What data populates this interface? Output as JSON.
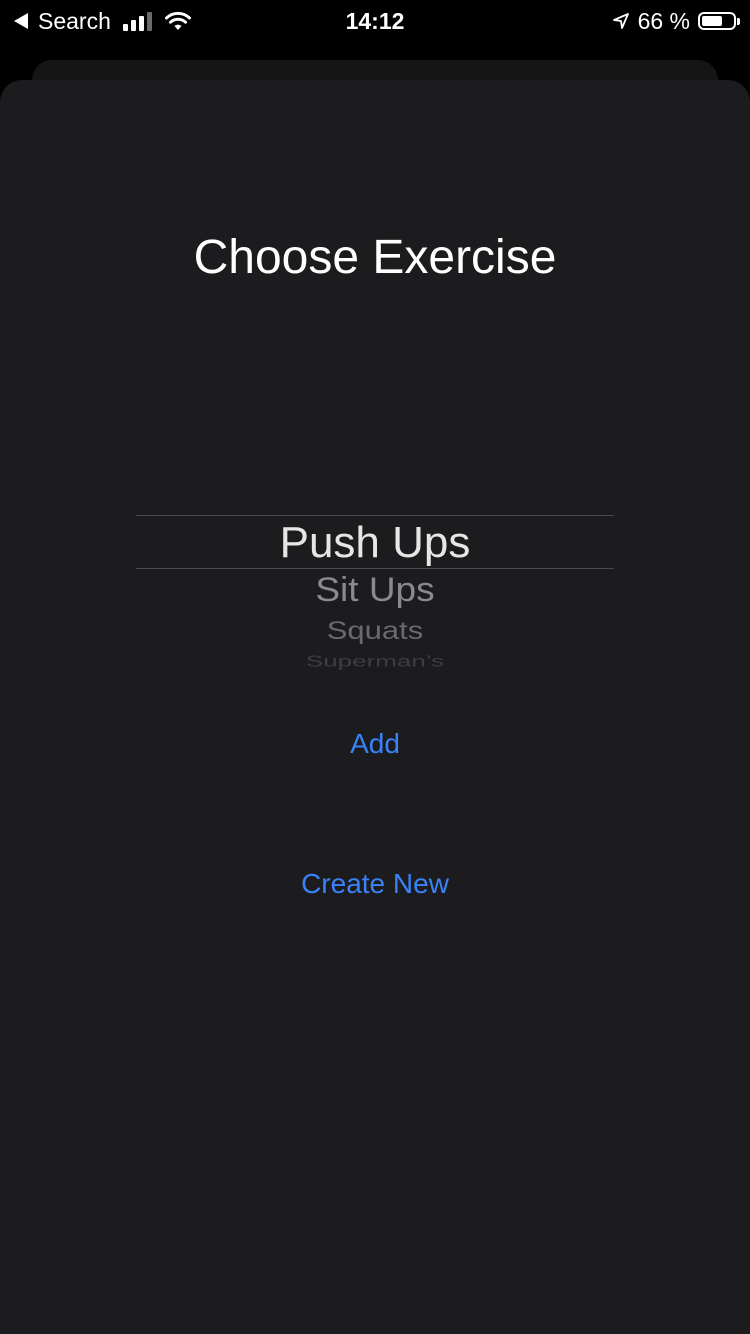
{
  "status_bar": {
    "back_app": "Search",
    "time": "14:12",
    "battery_percent_text": "66 %",
    "battery_level": 0.66,
    "icons": [
      "back-arrow-icon",
      "signal-icon",
      "wifi-icon",
      "location-arrow-icon",
      "battery-icon"
    ]
  },
  "sheet": {
    "title": "Choose Exercise"
  },
  "picker": {
    "selected": "Push Ups",
    "options": [
      "Push Ups",
      "Sit Ups",
      "Squats",
      "Superman’s"
    ]
  },
  "actions": {
    "add_label": "Add",
    "create_new_label": "Create New"
  },
  "colors": {
    "accent": "#3a82f7",
    "sheet_background": "#1c1c1e",
    "background": "#000000"
  }
}
